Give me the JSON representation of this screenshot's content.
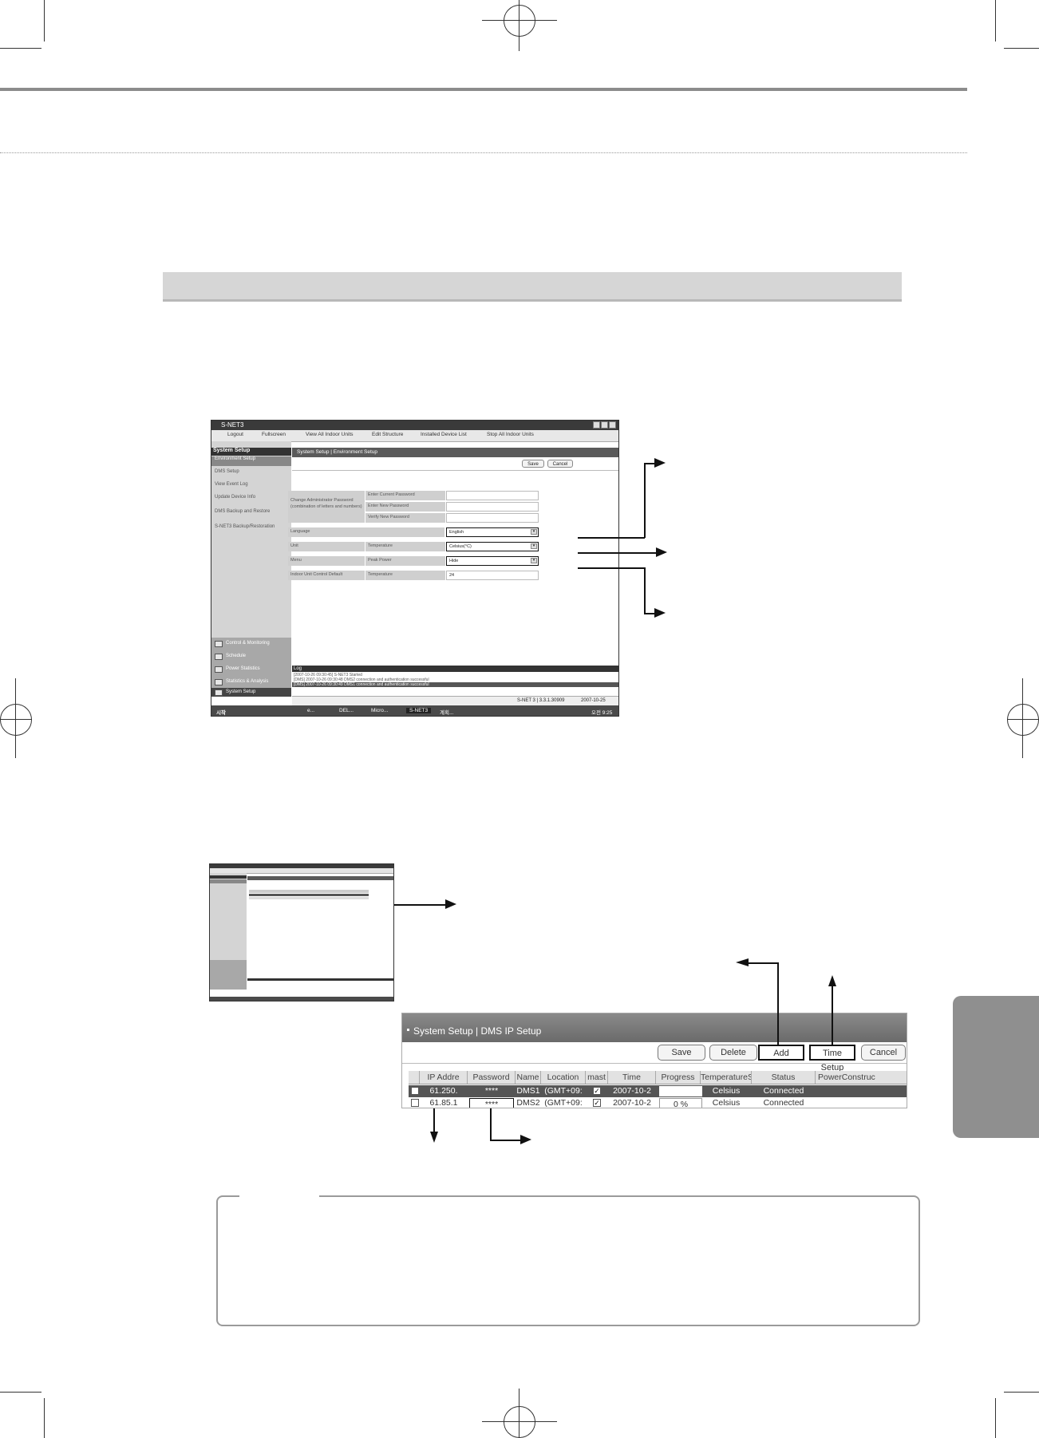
{
  "screenshot1": {
    "window_title": "S-NET3",
    "toolbar": [
      "Logout",
      "Fullscreen",
      "View All Indoor Units",
      "Edit Structure",
      "Installed Device List",
      "Stop All Indoor Units"
    ],
    "sidebar_header": "System Setup",
    "sidebar_items": [
      "Environment Setup",
      "DMS Setup",
      "View Event Log",
      "Update Device Info",
      "DMS Backup and Restore",
      "S-NET3 Backup/Restoration"
    ],
    "sidebar_bottom": [
      "Control & Monitoring",
      "Schedule",
      "Power Statistics",
      "Statistics & Analysis",
      "System Setup"
    ],
    "content_title": "System Setup | Environment Setup",
    "save_label": "Save",
    "cancel_label": "Cancel",
    "form": {
      "password_group": "Change Administrator Password (combination of letters and numbers)",
      "enter_current": "Enter Current Password",
      "enter_new": "Enter New Password",
      "verify_new": "Verify New Password",
      "language_label": "Language",
      "language_value": "English",
      "unit_label": "Unit",
      "temperature_label": "Temperature",
      "temperature_value": "Celsius(°C)",
      "menu_label": "Menu",
      "peak_power_label": "Peak Power",
      "peak_power_value": "Hide",
      "indoor_default_label": "Indoor Unit Control Default",
      "indoor_temp_label": "Temperature",
      "indoor_temp_value": "24"
    },
    "log_title": "Log",
    "log_lines": [
      "[2007-10-26 09:30:45] S-NET3 Started",
      "[DMS] 2007-10-26 09:30:48 DMS2 connection and authentication successful",
      "[DMS] 2007-10-26 09:30:49 DMS1 connection and authentication successful"
    ],
    "status_version": "S-NET 3 | 3.3.1.30909",
    "status_date": "2007-10-25",
    "taskbar": [
      "시작",
      "e...",
      "DEL...",
      "Micro...",
      "S-NET3",
      "계획..."
    ],
    "taskbar_time": "오전 9:25"
  },
  "dms": {
    "title": "System Setup | DMS IP Setup",
    "buttons": [
      "Save",
      "Delete",
      "Add",
      "Time Setup",
      "Cancel"
    ],
    "columns": [
      "IP Addre",
      "Password",
      "Name",
      "Location",
      "mast",
      "Time",
      "Progress",
      "TemperatureS",
      "Status",
      "PowerConstruc"
    ],
    "rows": [
      {
        "ip": "61.250.",
        "password": "****",
        "name": "DMS1",
        "location": "(GMT+09:",
        "time": "2007-10-2",
        "progress": "",
        "temperature": "Celsius",
        "status": "Connected"
      },
      {
        "ip": "61.85.1",
        "password": "****",
        "name": "DMS2",
        "location": "(GMT+09:",
        "time": "2007-10-2",
        "progress": "0 %",
        "temperature": "Celsius",
        "status": "Connected"
      }
    ]
  }
}
